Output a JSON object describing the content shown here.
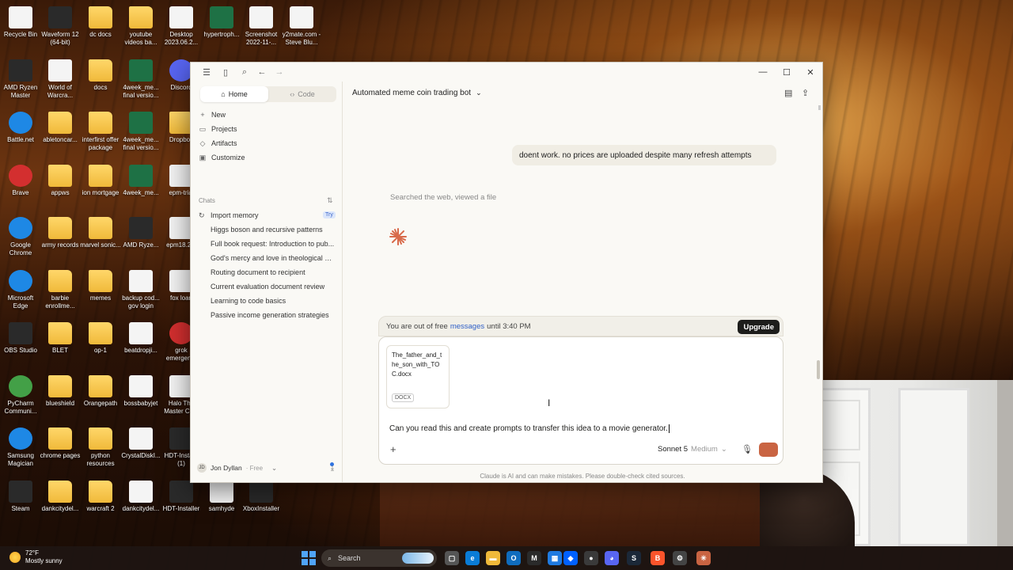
{
  "desktop": {
    "icons": [
      {
        "label": "Recycle Bin",
        "icon": "recycle-bin-icon"
      },
      {
        "label": "Waveform 12 (64-bit)",
        "icon": "waveform-icon"
      },
      {
        "label": "dc docs",
        "icon": "folder-icon"
      },
      {
        "label": "youtube videos ba...",
        "icon": "folder-icon"
      },
      {
        "label": "Desktop 2023.06.2...",
        "icon": "audio-file-icon"
      },
      {
        "label": "hypertroph...",
        "icon": "excel-icon"
      },
      {
        "label": "Screenshot 2022-11-...",
        "icon": "image-file-icon"
      },
      {
        "label": "y2mate.com - Steve Blu...",
        "icon": "audio-file-icon"
      },
      {
        "label": "AMD Ryzen Master",
        "icon": "amd-ryzen-icon"
      },
      {
        "label": "World of Warcra...",
        "icon": "file-icon"
      },
      {
        "label": "docs",
        "icon": "folder-icon"
      },
      {
        "label": "4week_me... final versio...",
        "icon": "excel-icon"
      },
      {
        "label": "Discord",
        "icon": "discord-icon"
      },
      {
        "label": "Battle.net",
        "icon": "battlenet-icon"
      },
      {
        "label": "abletoncar...",
        "icon": "folder-icon"
      },
      {
        "label": "interfirst offer package",
        "icon": "folder-icon"
      },
      {
        "label": "4week_me... final versio...",
        "icon": "excel-icon"
      },
      {
        "label": "Dropbox",
        "icon": "folder-icon"
      },
      {
        "label": "Brave",
        "icon": "brave-icon"
      },
      {
        "label": "appws",
        "icon": "folder-icon"
      },
      {
        "label": "ion mortgage",
        "icon": "folder-icon"
      },
      {
        "label": "4week_me...",
        "icon": "excel-icon"
      },
      {
        "label": "epm-trial",
        "icon": "file-icon"
      },
      {
        "label": "Google Chrome",
        "icon": "chrome-icon"
      },
      {
        "label": "army records",
        "icon": "folder-icon"
      },
      {
        "label": "marvel sonic...",
        "icon": "folder-icon"
      },
      {
        "label": "AMD Ryze...",
        "icon": "amd-ryzen-icon"
      },
      {
        "label": "epm18.2...",
        "icon": "file-icon"
      },
      {
        "label": "Microsoft Edge",
        "icon": "edge-icon"
      },
      {
        "label": "barbie enrollme...",
        "icon": "folder-icon"
      },
      {
        "label": "memes",
        "icon": "folder-icon"
      },
      {
        "label": "backup cod... gov login",
        "icon": "file-icon"
      },
      {
        "label": "fox loan",
        "icon": "file-icon"
      },
      {
        "label": "OBS Studio",
        "icon": "obs-icon"
      },
      {
        "label": "BLET",
        "icon": "folder-icon"
      },
      {
        "label": "op-1",
        "icon": "folder-icon"
      },
      {
        "label": "beatdropji...",
        "icon": "file-icon"
      },
      {
        "label": "grok emergen...",
        "icon": "brave-icon"
      },
      {
        "label": "PyCharm Communi...",
        "icon": "pycharm-icon"
      },
      {
        "label": "blueshield",
        "icon": "folder-icon"
      },
      {
        "label": "Orangepath",
        "icon": "folder-icon"
      },
      {
        "label": "bossbabyjet",
        "icon": "file-icon"
      },
      {
        "label": "Halo The Master Ch...",
        "icon": "file-icon"
      },
      {
        "label": "Samsung Magician",
        "icon": "samsung-icon"
      },
      {
        "label": "chrome pages",
        "icon": "folder-icon"
      },
      {
        "label": "python resources",
        "icon": "folder-icon"
      },
      {
        "label": "CrystalDiskI...",
        "icon": "file-icon"
      },
      {
        "label": "HDT-Insta... (1)",
        "icon": "app-icon"
      },
      {
        "label": "Steam",
        "icon": "steam-icon"
      },
      {
        "label": "dankcitydel...",
        "icon": "folder-icon"
      },
      {
        "label": "warcraft 2",
        "icon": "folder-icon"
      },
      {
        "label": "dankcitydel...",
        "icon": "file-icon"
      },
      {
        "label": "HDT-Installer",
        "icon": "app-icon"
      },
      {
        "label": "samhyde",
        "icon": "file-icon"
      },
      {
        "label": "XboxInstaller",
        "icon": "xbox-icon"
      }
    ]
  },
  "app": {
    "sidebar": {
      "tabs": [
        {
          "label": "Home",
          "icon": "home-icon"
        },
        {
          "label": "Code",
          "icon": "code-icon"
        }
      ],
      "nav": [
        {
          "label": "New",
          "icon": "plus-icon"
        },
        {
          "label": "Projects",
          "icon": "projects-icon"
        },
        {
          "label": "Artifacts",
          "icon": "artifacts-icon"
        },
        {
          "label": "Customize",
          "icon": "customize-icon"
        }
      ],
      "chats_label": "Chats",
      "try_badge": "Try",
      "chats": [
        "Import memory",
        "Higgs boson and recursive patterns",
        "Full book request: Introduction to pub...",
        "God's mercy and love in theological ev...",
        "Routing document to recipient",
        "Current evaluation document review",
        "Learning to code basics",
        "Passive income generation strategies"
      ],
      "user": {
        "initials": "JD",
        "name": "Jon Dyllan",
        "plan": "· Free"
      }
    },
    "main": {
      "chat_title": "Automated meme coin trading bot",
      "user_message": "doent work. no prices are uploaded despite many refresh attempts",
      "status_line": "Searched the web, viewed a file",
      "limit": {
        "prefix": "You are out of free",
        "link": "messages",
        "suffix": "until 3:40 PM",
        "upgrade": "Upgrade"
      },
      "attachment": {
        "name": "The_father_and_the_son_with_TOC.docx",
        "type": "DOCX"
      },
      "prompt_text": "Can you read this and create prompts to transfer this idea to a movie generator.",
      "model": "Sonnet 5",
      "effort": "Medium",
      "disclaimer": "Claude is AI and can make mistakes. Please double-check cited sources.",
      "accent_color": "#c96442"
    }
  },
  "taskbar": {
    "weather_temp": "72°F",
    "weather_desc": "Mostly sunny",
    "search_placeholder": "Search"
  }
}
